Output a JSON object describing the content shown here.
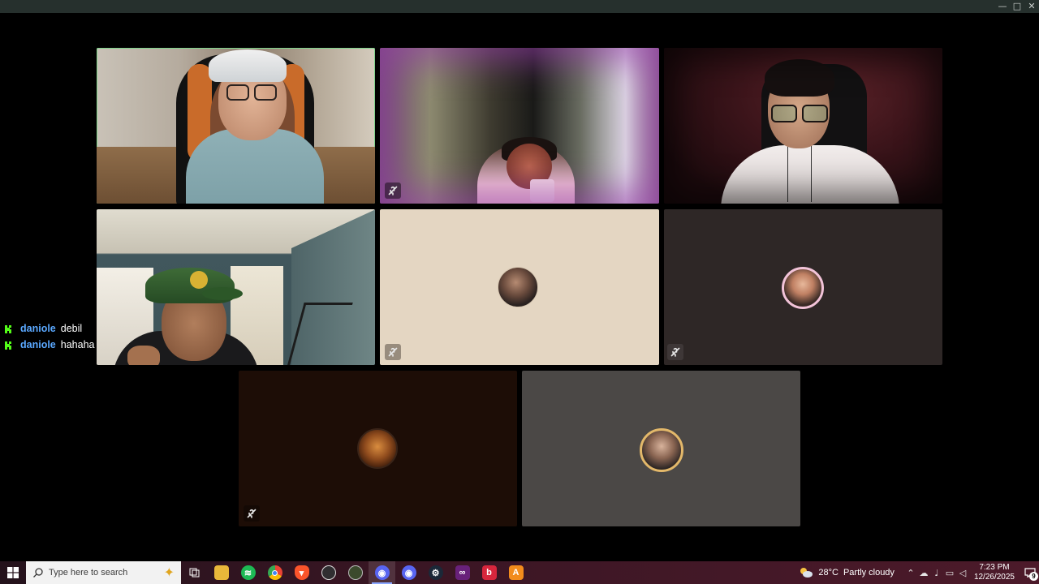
{
  "window": {
    "controls": {
      "minimize": "—",
      "maximize": "□",
      "close": "✕"
    }
  },
  "chat": {
    "messages": [
      {
        "user": "daniole",
        "text": "debil"
      },
      {
        "user": "daniole",
        "text": "hahaha"
      }
    ]
  },
  "tiles": [
    {
      "id": 1,
      "kind": "video",
      "speaking": true,
      "muted": false
    },
    {
      "id": 2,
      "kind": "video",
      "muted": true
    },
    {
      "id": 3,
      "kind": "video",
      "muted": false
    },
    {
      "id": 4,
      "kind": "video",
      "muted": false
    },
    {
      "id": 5,
      "kind": "avatar",
      "muted": true
    },
    {
      "id": 6,
      "kind": "avatar",
      "muted": true
    },
    {
      "id": 7,
      "kind": "avatar",
      "muted": true
    },
    {
      "id": 8,
      "kind": "avatar",
      "muted": false
    }
  ],
  "taskbar": {
    "search_placeholder": "Type here to search",
    "apps": [
      "task-view",
      "file-explorer",
      "spotify",
      "chrome",
      "brave",
      "obs",
      "app-globe",
      "discord-active",
      "discord",
      "steam",
      "visual-studio",
      "app-red",
      "app-orange"
    ],
    "weather": {
      "temp": "28°C",
      "condition": "Partly cloudy"
    },
    "clock": {
      "time": "7:23 PM",
      "date": "12/26/2025"
    },
    "notifications": "9"
  },
  "colors": {
    "chat_user": "#5aa8ff",
    "speaking_border": "#7fd48b",
    "taskbar": "#3a1624"
  }
}
